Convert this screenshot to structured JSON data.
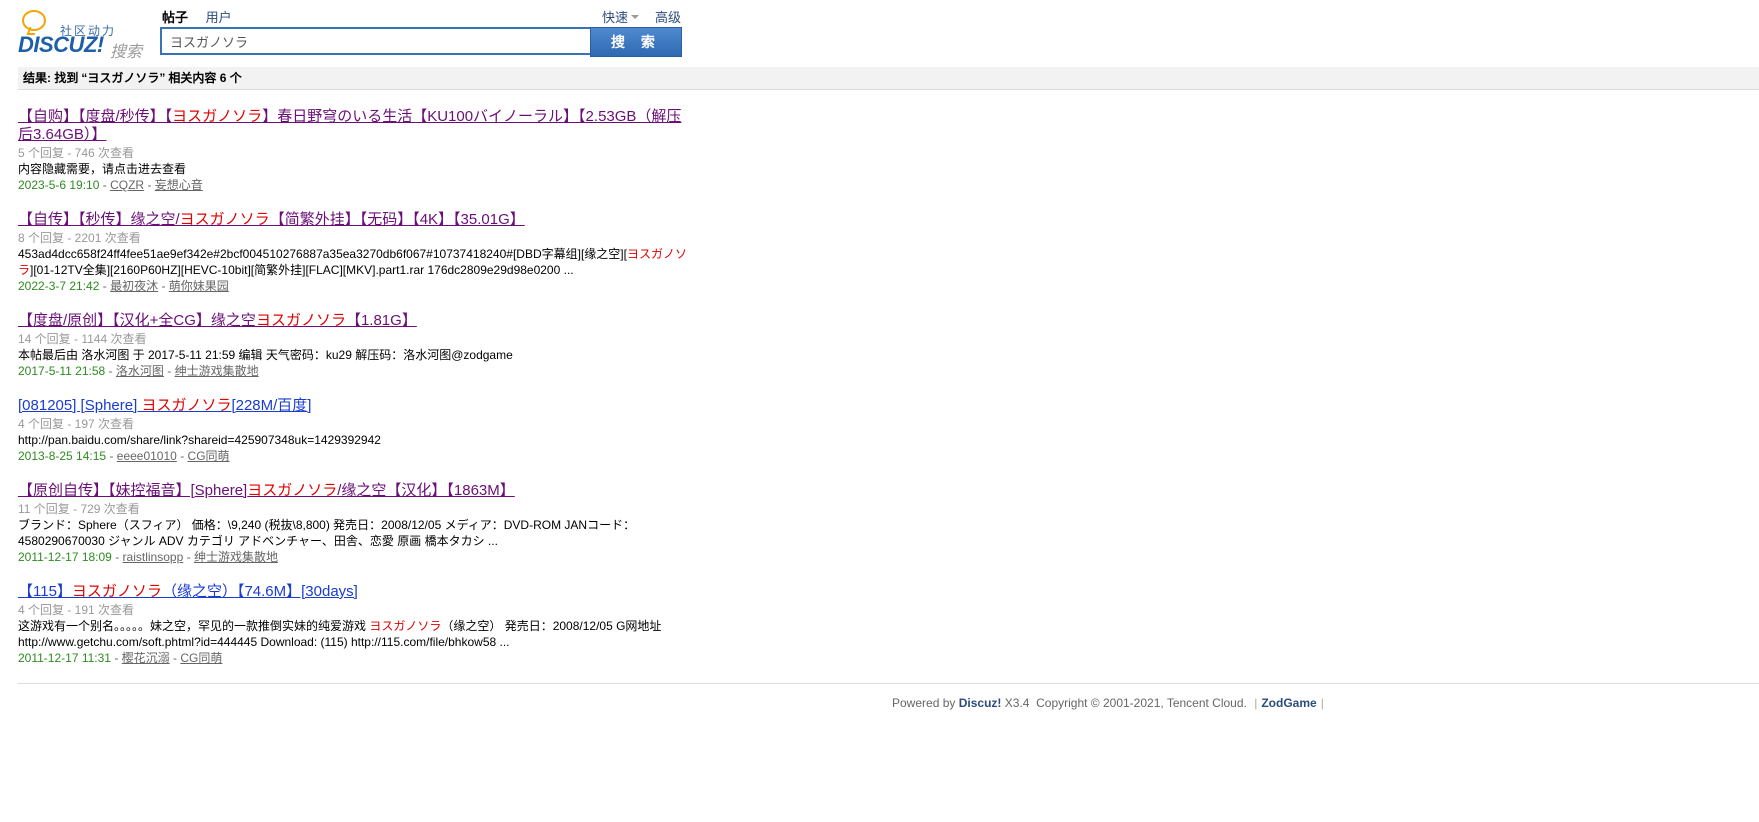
{
  "header": {
    "logo": {
      "slogan": "社区动力",
      "word": "DISCUZ!",
      "sub": "搜索"
    },
    "tabs": [
      {
        "label": "帖子"
      },
      {
        "label": "用户"
      }
    ],
    "quick_label": "快速",
    "advanced_label": "高级",
    "search": {
      "value": "ヨスガノソラ",
      "button_label": "搜 索"
    }
  },
  "result_bar": {
    "prefix": "结果: 找到",
    "query": "“ヨスガノソラ”",
    "suffix": "相关内容 6 个"
  },
  "results": [
    {
      "title_parts": [
        "【自购】【度盘/秒传】【",
        "ヨスガノソラ",
        "】春日野穹のいる生活【KU100バイノーラル】【2.53GB（解压后3.64GB）】"
      ],
      "meta": "5 个回复 - 746 次查看",
      "desc_parts": [
        "内容隐藏需要，请点击进去查看",
        "",
        ""
      ],
      "date": "2023-5-6 19:10",
      "author": "CQZR",
      "forum": "妄想心音"
    },
    {
      "title_parts": [
        "【自传】【秒传】缘之空/",
        "ヨスガノソラ",
        "【简繁外挂】【无码】【4K】【35.01G】"
      ],
      "meta": "8 个回复 - 2201 次查看",
      "desc_parts": [
        "453ad4dcc658f24ff4fee51ae9ef342e#2bcf004510276887a35ea3270db6f067#10737418240#[DBD字幕组][缘之空][",
        "ヨスガノソラ",
        "][01-12TV全集][2160P60HZ][HEVC-10bit][简繁外挂][FLAC][MKV].part1.rar 176dc2809e29d98e0200 ..."
      ],
      "date": "2022-3-7 21:42",
      "author": "最初夜沐",
      "forum": "萌你妹果园"
    },
    {
      "title_parts": [
        "【度盘/原创】【汉化+全CG】缘之空",
        "ヨスガノソラ",
        "【1.81G】"
      ],
      "meta": "14 个回复 - 1144 次查看",
      "desc_parts": [
        "本帖最后由 洛水河图 于 2017-5-11 21:59 编辑 天气密码：ku29 解压码：洛水河图@zodgame",
        "",
        ""
      ],
      "date": "2017-5-11 21:58",
      "author": "洛水河图",
      "forum": "绅士游戏集散地"
    },
    {
      "title_parts": [
        "[081205] [Sphere] ",
        "ヨスガノソラ",
        "[228M/百度]"
      ],
      "title_color": "blue",
      "meta": "4 个回复 - 197 次查看",
      "desc_parts": [
        "http://pan.baidu.com/share/link?shareid=425907348uk=1429392942",
        "",
        ""
      ],
      "date": "2013-8-25 14:15",
      "author": "eeee01010",
      "forum": "CG同萌"
    },
    {
      "title_parts": [
        "【原创自传】【妹控福音】[Sphere]",
        "ヨスガノソラ",
        "/缘之空【汉化】【1863M】"
      ],
      "meta": "11 个回复 - 729 次查看",
      "desc_parts": [
        "ブランド：Sphere（スフィア） 価格：\\9,240 (税抜\\8,800) 発売日：2008/12/05 メディア：DVD-ROM JANコード：4580290670030 ジャンル ADV カテゴリ アドベンチャー、田舎、恋愛 原画 橋本タカシ ...",
        "",
        ""
      ],
      "date": "2011-12-17 18:09",
      "author": "raistlinsopp",
      "forum": "绅士游戏集散地"
    },
    {
      "title_parts": [
        "【115】",
        "ヨスガノソラ",
        "（缘之空）【74.6M】[30days]"
      ],
      "title_color": "blue",
      "meta": "4 个回复 - 191 次查看",
      "desc_parts": [
        "这游戏有一个别名。。。。。妹之空，罕见的一款推倒实妹的纯爱游戏 ",
        "ヨスガノソラ",
        "（缘之空） 発売日：2008/12/05 G网地址 http://www.getchu.com/soft.phtml?id=444445 Download: (115) http://115.com/file/bhkow58 ..."
      ],
      "date": "2011-12-17 11:31",
      "author": "樱花沉溺",
      "forum": "CG同萌"
    }
  ],
  "footer": {
    "powered_prefix": "Powered by",
    "powered_brand": "Discuz!",
    "version": "X3.4",
    "copyright": "Copyright © 2001-2021, Tencent Cloud.",
    "site": "ZodGame"
  }
}
